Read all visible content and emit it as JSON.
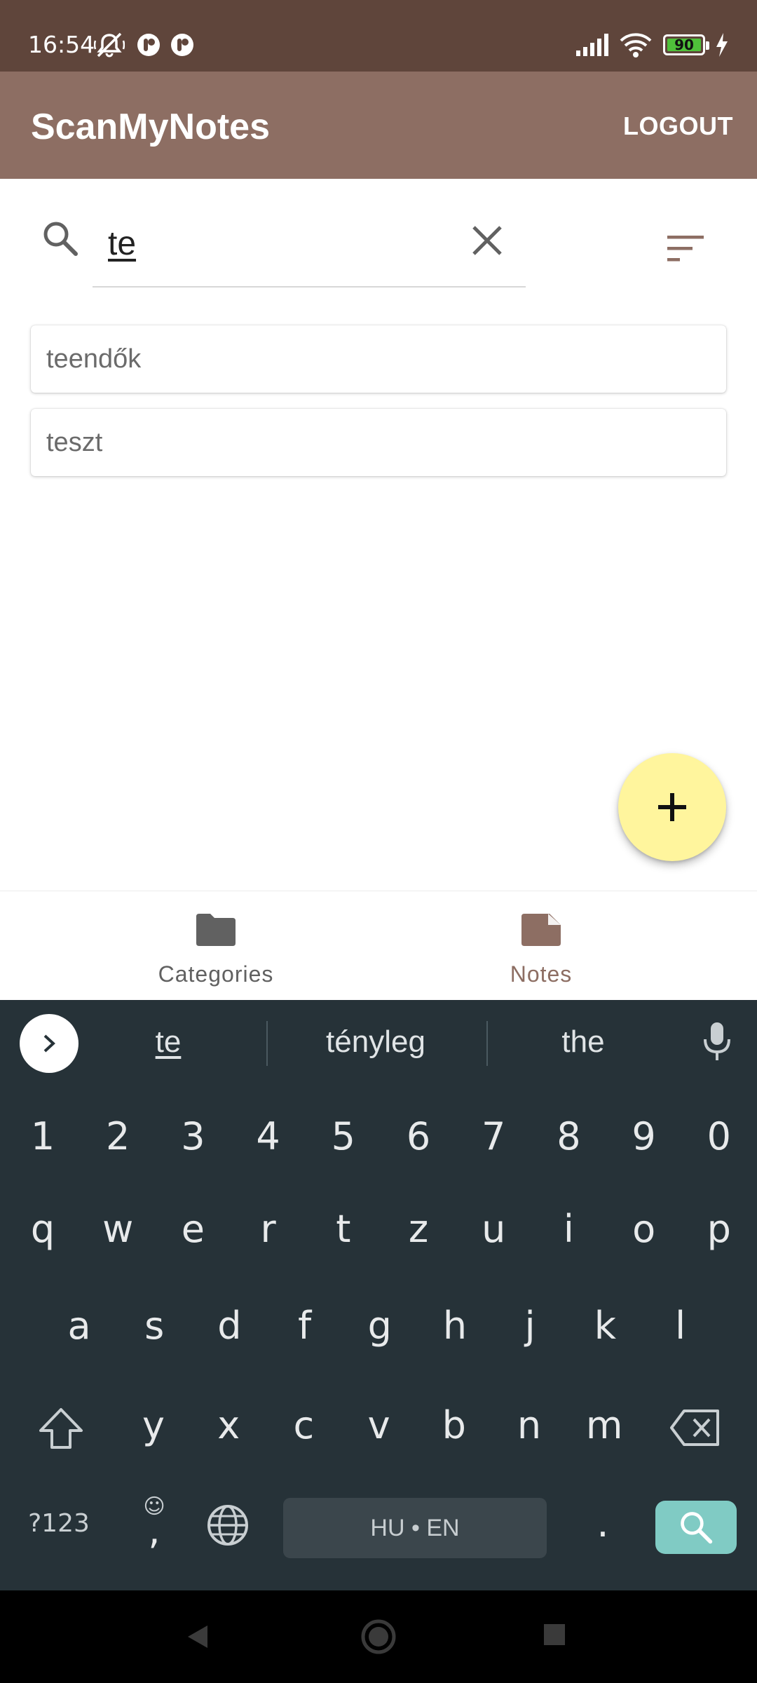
{
  "status_bar": {
    "time": "16:54",
    "battery": "90",
    "icons": [
      "mute-icon",
      "app-notification-icon",
      "app-notification-icon",
      "signal-icon",
      "wifi-icon",
      "battery-icon",
      "charging-icon"
    ]
  },
  "app_bar": {
    "title": "ScanMyNotes",
    "logout_label": "LOGOUT"
  },
  "search": {
    "value": "te",
    "icons": [
      "search-icon",
      "close-icon",
      "sort-icon"
    ]
  },
  "results": [
    {
      "label": "teendők"
    },
    {
      "label": "teszt"
    }
  ],
  "fab": {
    "icon": "plus-icon"
  },
  "bottom_nav": {
    "categories_label": "Categories",
    "notes_label": "Notes",
    "active": "Notes",
    "active_color": "#8d6e63",
    "inactive_color": "#616161"
  },
  "keyboard": {
    "suggestions": [
      "te",
      "tényleg",
      "the"
    ],
    "number_row": [
      "1",
      "2",
      "3",
      "4",
      "5",
      "6",
      "7",
      "8",
      "9",
      "0"
    ],
    "row1": [
      "q",
      "w",
      "e",
      "r",
      "t",
      "z",
      "u",
      "i",
      "o",
      "p"
    ],
    "row2": [
      "a",
      "s",
      "d",
      "f",
      "g",
      "h",
      "j",
      "k",
      "l"
    ],
    "row3": [
      "y",
      "x",
      "c",
      "v",
      "b",
      "n",
      "m"
    ],
    "symbols_label": "?123",
    "comma_label": ",",
    "period_label": ".",
    "space_label": "HU • EN",
    "emoji_hint": "☺"
  },
  "colors": {
    "status_bar": "#5f453b",
    "app_bar": "#8d6e63",
    "fab": "#fff59d",
    "keyboard_bg": "#263238",
    "enter_key": "#80cbc4"
  }
}
